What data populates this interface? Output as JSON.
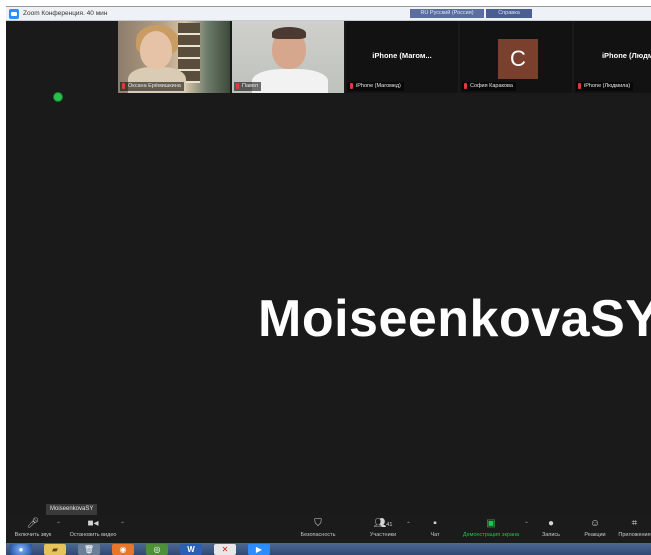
{
  "window": {
    "title": "Zoom Конференция. 40 мин",
    "lang_indicator": "RU Русский (Россия)",
    "help_indicator": "Справка"
  },
  "gallery": [
    {
      "name": "Оксана Ерёмишкина",
      "type": "video"
    },
    {
      "name": "Павел",
      "type": "video"
    },
    {
      "center_name": "iPhone (Магом...",
      "name": "iPhone (Магомед)",
      "type": "name"
    },
    {
      "avatar_letter": "C",
      "name": "София Каракова",
      "type": "avatar",
      "avatar_color": "#7b3f2e"
    },
    {
      "center_name": "iPhone (Людми",
      "name": "iPhone (Людмила)",
      "type": "name"
    }
  ],
  "main": {
    "speaker_name": "MoiseenkovaSY"
  },
  "self_view": {
    "label": "MoiseenkovaSY"
  },
  "toolbar": {
    "mute": {
      "label": "Включить звук",
      "icon": "microphone-muted-icon"
    },
    "video": {
      "label": "Остановить видео",
      "icon": "video-camera-icon"
    },
    "security": {
      "label": "Безопасность",
      "icon": "shield-icon"
    },
    "participants": {
      "label": "Участники",
      "count": "41",
      "icon": "participants-icon"
    },
    "chat": {
      "label": "Чат",
      "icon": "chat-icon"
    },
    "share": {
      "label": "Демонстрация экрана",
      "icon": "share-screen-icon"
    },
    "record": {
      "label": "Запись",
      "icon": "record-icon"
    },
    "reactions": {
      "label": "Реакции",
      "icon": "reactions-icon"
    },
    "apps": {
      "label": "Приложения",
      "icon": "apps-icon"
    }
  },
  "colors": {
    "accent_green": "#27c24c",
    "background": "#1a1a1a",
    "name_tag_red": "#e03a3a"
  },
  "taskbar": [
    {
      "icon": "start-button-icon",
      "glyph": "●"
    },
    {
      "icon": "file-explorer-icon",
      "glyph": "▰"
    },
    {
      "icon": "recycle-bin-icon",
      "glyph": "🗑"
    },
    {
      "icon": "firefox-icon",
      "glyph": "◉"
    },
    {
      "icon": "chrome-icon",
      "glyph": "◎"
    },
    {
      "icon": "word-icon",
      "glyph": "W"
    },
    {
      "icon": "yandex-icon",
      "glyph": "✕"
    },
    {
      "icon": "zoom-taskbar-icon",
      "glyph": "▶"
    }
  ]
}
